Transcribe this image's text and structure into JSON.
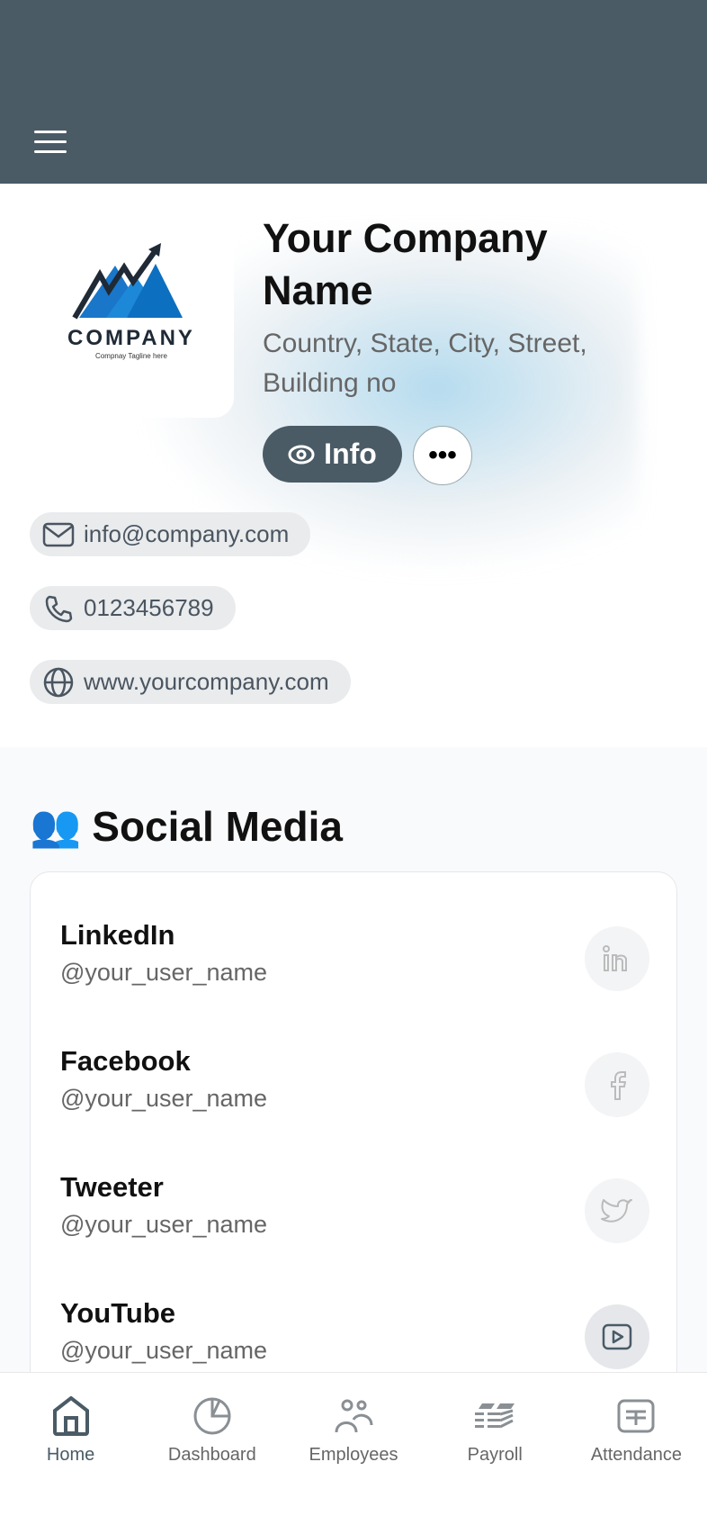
{
  "header": {
    "menu_icon": "hamburger-icon",
    "bg": "#4a5b66"
  },
  "company": {
    "logo_text": "COMPANY",
    "logo_tagline": "Compnay Tagline here",
    "name": "Your Company Name",
    "address": "Country, State, City, Street, Building no",
    "info_label": "Info",
    "more_label": "•••"
  },
  "contacts": [
    {
      "icon": "mail-icon",
      "text": "info@company.com"
    },
    {
      "icon": "phone-icon",
      "text": "0123456789"
    },
    {
      "icon": "globe-icon",
      "text": "www.yourcompany.com"
    }
  ],
  "social": {
    "title": "Social Media",
    "emoji": "👥",
    "items": [
      {
        "name": "LinkedIn",
        "user": "@your_user_name",
        "icon": "linkedin-icon"
      },
      {
        "name": "Facebook",
        "user": "@your_user_name",
        "icon": "facebook-icon"
      },
      {
        "name": "Tweeter",
        "user": "@your_user_name",
        "icon": "twitter-icon"
      },
      {
        "name": "YouTube",
        "user": "@your_user_name",
        "icon": "youtube-icon"
      }
    ]
  },
  "nav": [
    {
      "label": "Home",
      "active": true
    },
    {
      "label": "Dashboard"
    },
    {
      "label": "Employees"
    },
    {
      "label": "Payroll"
    },
    {
      "label": "Attendance"
    }
  ]
}
